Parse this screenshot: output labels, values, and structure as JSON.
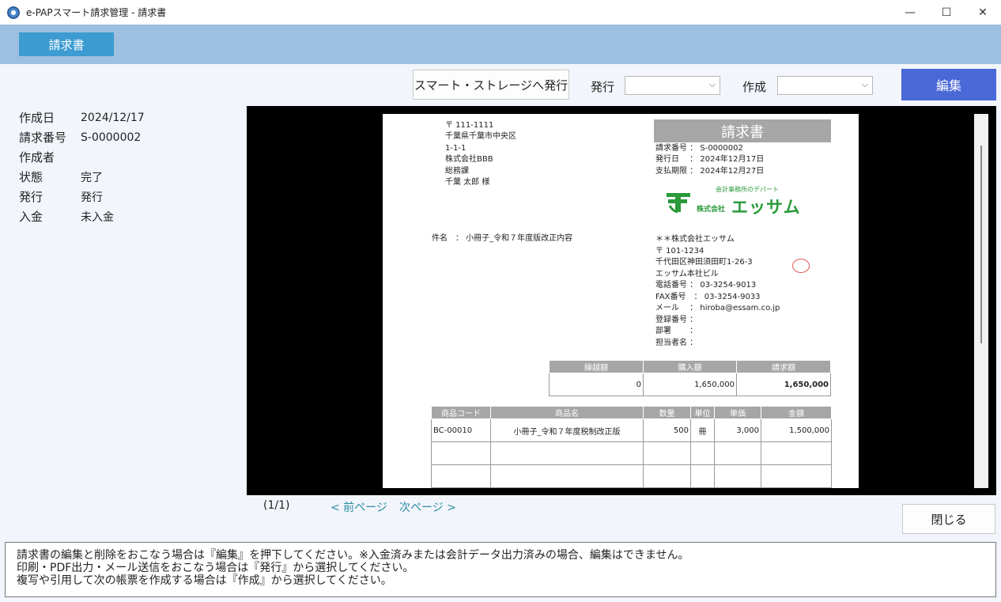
{
  "window": {
    "title": "e-PAPスマート請求管理 - 請求書",
    "minimize": "—",
    "maximize": "☐",
    "close": "✕"
  },
  "tabbar": {
    "active_tab": "請求書"
  },
  "toolbar": {
    "issue_storage_label": "スマート・ストレージへ発行",
    "issue_label": "発行",
    "issue_value": "",
    "create_label": "作成",
    "create_value": "",
    "edit_label": "編集"
  },
  "info": [
    {
      "key": "作成日",
      "value": "2024/12/17"
    },
    {
      "key": "請求番号",
      "value": "S-0000002"
    },
    {
      "key": "作成者",
      "value": ""
    },
    {
      "key": "状態",
      "value": "完了"
    },
    {
      "key": "発行",
      "value": "発行"
    },
    {
      "key": "入金",
      "value": "未入金"
    }
  ],
  "invoice": {
    "recipient": [
      "〒 111-1111",
      "千葉県千葉市中央区",
      "1-1-1",
      "株式会社BBB",
      "総務課",
      "千葉 太郎 様"
    ],
    "title": "請求書",
    "meta": [
      "請求番号 ： S-0000002",
      "発行日　 ： 2024年12月17日",
      "支払期限 ： 2024年12月27日"
    ],
    "logo": {
      "tagline": "会計事務所のデパート",
      "company_prefix": "株式会社",
      "company_name": "エッサム"
    },
    "subject": "件名　： 小冊子_令和７年度版改正内容",
    "issuer": [
      "＊＊株式会社エッサム",
      "〒 101-1234",
      "千代田区神田須田町1-26-3",
      "エッサム本社ビル",
      "電話番号 ： 03-3254-9013",
      "FAX番号　： 03-3254-9033",
      "メール　 ： hiroba@essam.co.jp",
      "登録番号 ：",
      "部署　　 ：",
      "担当者名 ："
    ],
    "summary": {
      "headers": [
        "繰越額",
        "購入額",
        "請求額"
      ],
      "values": [
        "0",
        "1,650,000",
        "1,650,000"
      ]
    },
    "items": {
      "headers": [
        "商品コード",
        "商品名",
        "数量",
        "単位",
        "単価",
        "金額"
      ],
      "rows": [
        [
          "BC-00010",
          "小冊子_令和７年度税制改正版",
          "500",
          "冊",
          "3,000",
          "1,500,000"
        ],
        [
          "",
          "",
          "",
          "",
          "",
          ""
        ],
        [
          "",
          "",
          "",
          "",
          "",
          ""
        ]
      ]
    }
  },
  "pager": {
    "page_indicator": "(1/1)",
    "prev": "< 前ページ",
    "next": "次ページ >"
  },
  "footer": {
    "close_label": "閉じる",
    "help_lines": [
      "請求書の編集と削除をおこなう場合は『編集』を押下してください。※入金済みまたは会計データ出力済みの場合、編集はできません。",
      "印刷・PDF出力・メール送信をおこなう場合は『発行』から選択してください。",
      "複写や引用して次の帳票を作成する場合は『作成』から選択してください。"
    ]
  },
  "colors": {
    "accent_blue": "#4a68d6",
    "tab_blue": "#3c9bd1",
    "header_band": "#9dbfe0",
    "link_teal": "#2f8fa6",
    "logo_green": "#2a9a3a"
  }
}
